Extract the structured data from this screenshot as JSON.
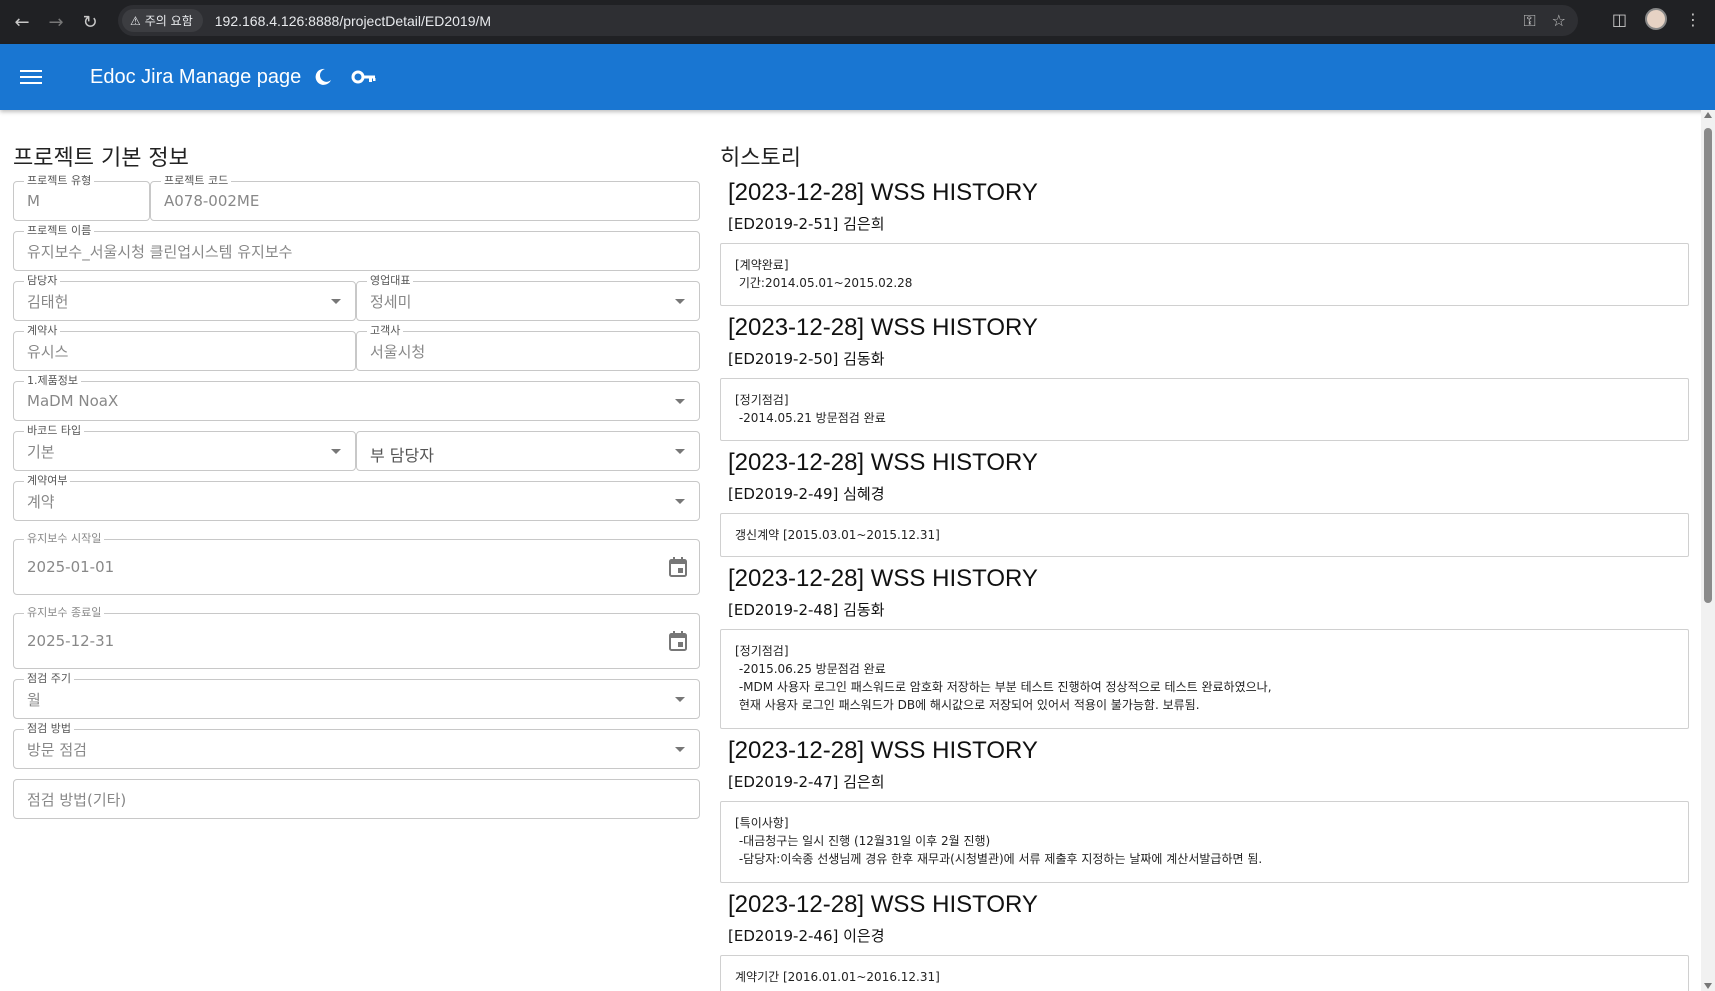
{
  "browser": {
    "warning_chip": "주의 요함",
    "url": "192.168.4.126:8888/projectDetail/ED2019/M"
  },
  "appbar": {
    "title": "Edoc Jira Manage page"
  },
  "form": {
    "title": "프로젝트 기본 정보",
    "project_type": {
      "label": "프로젝트 유형",
      "value": "M"
    },
    "project_code": {
      "label": "프로젝트 코드",
      "value": "A078-002ME"
    },
    "project_name": {
      "label": "프로젝트 이름",
      "value": "유지보수_서울시청 클린업시스템 유지보수"
    },
    "manager": {
      "label": "담당자",
      "value": "김태헌"
    },
    "sales_rep": {
      "label": "영업대표",
      "value": "정세미"
    },
    "contractor": {
      "label": "계약사",
      "value": "유시스"
    },
    "client": {
      "label": "고객사",
      "value": "서울시청"
    },
    "product_info": {
      "label": "1.제품정보",
      "value": "MaDM NoaX"
    },
    "barcode_type": {
      "label": "바코드 타입",
      "value": "기본"
    },
    "sub_manager": {
      "placeholder": "부 담당자"
    },
    "contract_status": {
      "label": "계약여부",
      "value": "계약"
    },
    "maint_start": {
      "label": "유지보수 시작일",
      "value": "2025-01-01"
    },
    "maint_end": {
      "label": "유지보수 종료일",
      "value": "2025-12-31"
    },
    "inspect_cycle": {
      "label": "점검 주기",
      "value": "월"
    },
    "inspect_method": {
      "label": "점검 방법",
      "value": "방문 점검"
    },
    "inspect_method_other": {
      "placeholder": "점검 방법(기타)"
    }
  },
  "history": {
    "title": "히스토리",
    "entries": [
      {
        "heading": "[2023-12-28] WSS HISTORY",
        "sub": "[ED2019-2-51] 김은희",
        "body": "[계약완료]\n 기간:2014.05.01~2015.02.28"
      },
      {
        "heading": "[2023-12-28] WSS HISTORY",
        "sub": "[ED2019-2-50] 김동화",
        "body": "[정기점검]\n -2014.05.21 방문점검 완료"
      },
      {
        "heading": "[2023-12-28] WSS HISTORY",
        "sub": "[ED2019-2-49] 심혜경",
        "body": "갱신계약 [2015.03.01~2015.12.31]"
      },
      {
        "heading": "[2023-12-28] WSS HISTORY",
        "sub": "[ED2019-2-48] 김동화",
        "body": "[정기점검]\n -2015.06.25 방문점검 완료\n -MDM 사용자 로그인 패스워드로 암호화 저장하는 부분 테스트 진행하여 정상적으로 테스트 완료하였으나,\n 현재 사용자 로그인 패스워드가 DB에 해시값으로 저장되어 있어서 적용이 불가능함. 보류됨."
      },
      {
        "heading": "[2023-12-28] WSS HISTORY",
        "sub": "[ED2019-2-47] 김은희",
        "body": "[특이사항]\n -대금청구는 일시 진행 (12월31일 이후 2월 진행)\n -담당자:이숙종 선생님께 경유 한후 재무과(시청별관)에 서류 제출후 지정하는 날짜에 계산서발급하면 됨."
      },
      {
        "heading": "[2023-12-28] WSS HISTORY",
        "sub": "[ED2019-2-46] 이은경",
        "body": "계약기간 [2016.01.01~2016.12.31]"
      }
    ]
  }
}
